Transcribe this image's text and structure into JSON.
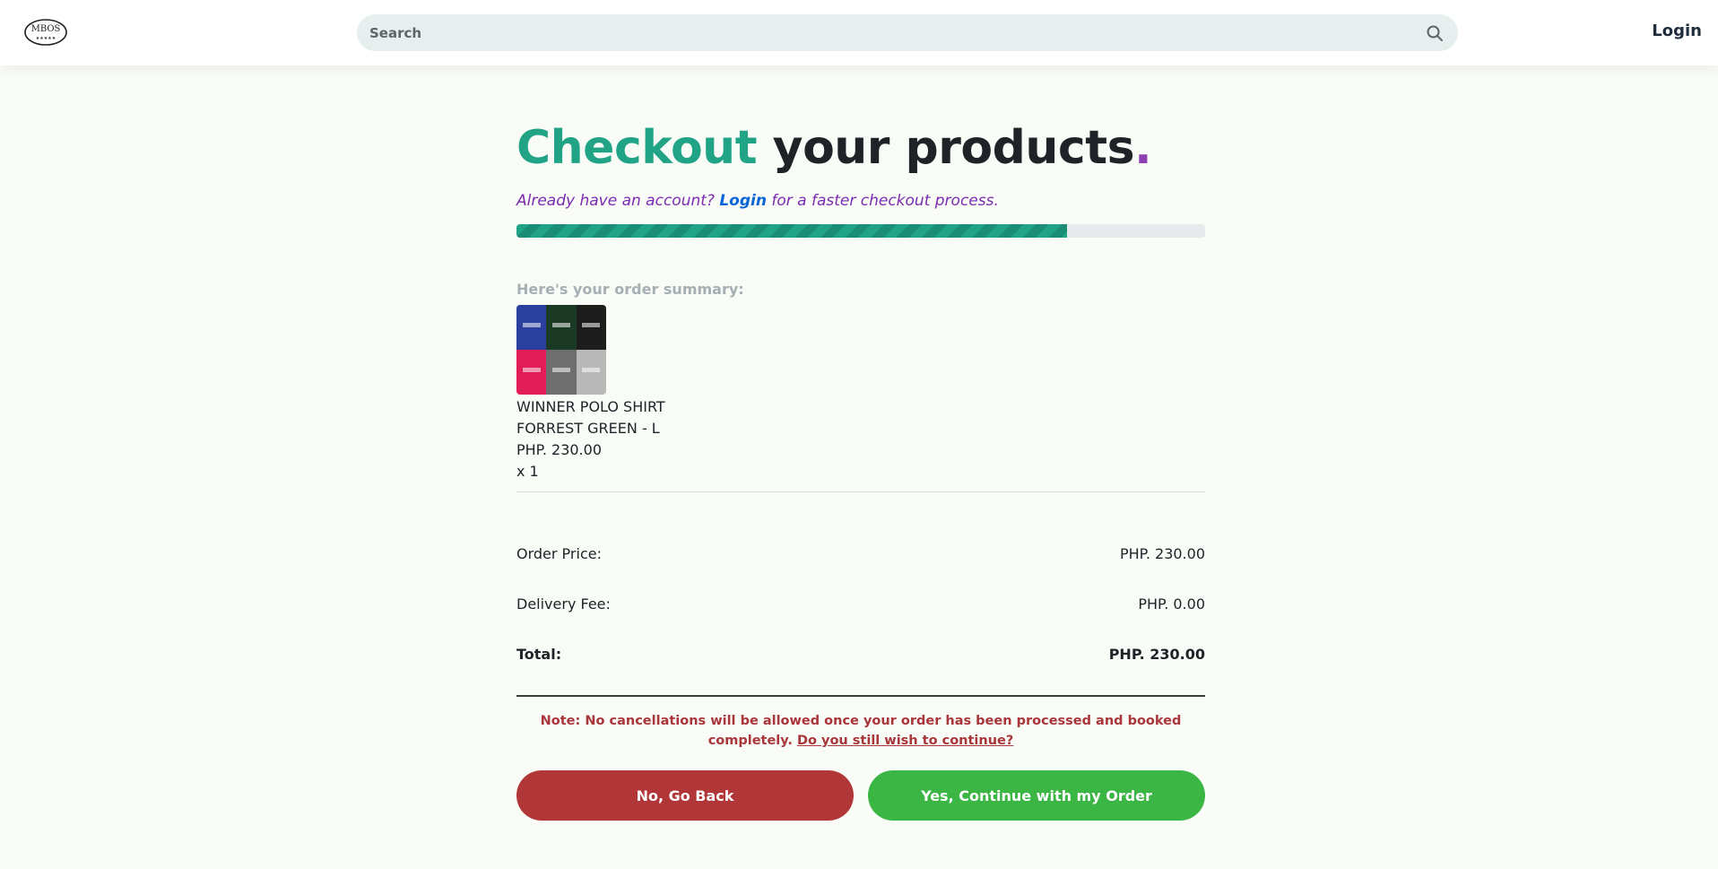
{
  "header": {
    "logo_text": "MBOS",
    "search_placeholder": "Search",
    "login_label": "Login"
  },
  "checkout": {
    "title_accent": "Checkout",
    "title_rest": " your products",
    "title_dot": ".",
    "subtitle_before": "Already have an account? ",
    "subtitle_login": "Login",
    "subtitle_after": " for a faster checkout process.",
    "progress_percent": 80
  },
  "order_summary": {
    "label": "Here's your order summary:",
    "items": [
      {
        "name": "WINNER POLO SHIRT",
        "variant": "FORREST GREEN - L",
        "price": "PHP. 230.00",
        "quantity": "x 1"
      }
    ]
  },
  "pricing": {
    "order_price_label": "Order Price:",
    "order_price_value": "PHP. 230.00",
    "delivery_fee_label": "Delivery Fee:",
    "delivery_fee_value": "PHP. 0.00",
    "total_label": "Total:",
    "total_value": "PHP. 230.00"
  },
  "note": {
    "text": "Note: No cancellations will be allowed once your order has been processed and booked completely. ",
    "link": "Do you still wish to continue?"
  },
  "actions": {
    "back_label": "No, Go Back",
    "continue_label": "Yes, Continue with my Order"
  },
  "colors": {
    "accent": "#21a386",
    "purple": "#7b2bb0",
    "danger": "#b13637",
    "success": "#3bb544"
  }
}
